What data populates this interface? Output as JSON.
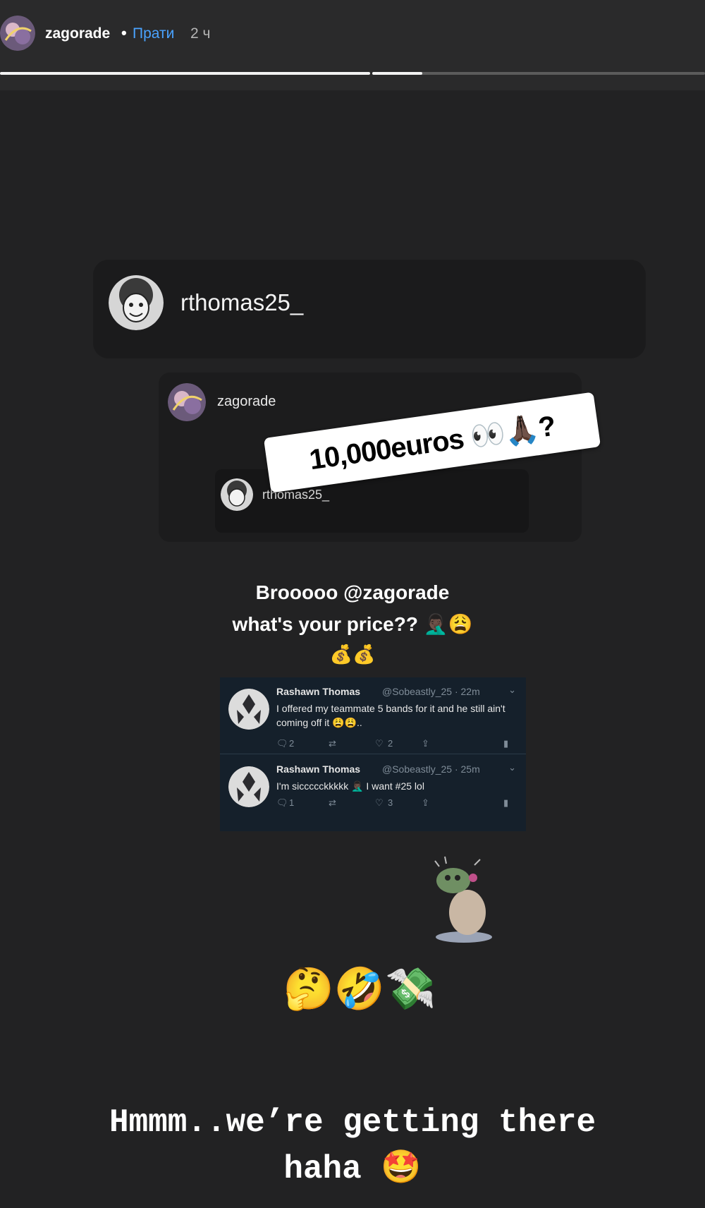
{
  "header": {
    "username": "zagorade",
    "separator": "•",
    "follow_label": "Прати",
    "time": "2 ч",
    "progress": [
      1.0,
      0.15
    ]
  },
  "repost": {
    "username": "rthomas25_",
    "inner": {
      "username": "zagorade",
      "nested_username": "rthomas25_"
    }
  },
  "sticker": {
    "text": "10,000euros 👀🙏🏿?"
  },
  "caption": {
    "line1": "Brooooo @zagorade",
    "line2": "what's your price?? 🤦🏿‍♂️😩",
    "line3": "💰💰"
  },
  "tweets": [
    {
      "name": "Rashawn Thomas",
      "handle": "@Sobeastly_25 · 22m",
      "text": "I offered my teammate 5 bands for it and he still ain't coming off it 😩😩..",
      "replies": "2",
      "likes": "2"
    },
    {
      "name": "Rashawn Thomas",
      "handle": "@Sobeastly_25 · 25m",
      "text": "I'm siccccckkkkk 🤦🏿‍♂️ I want #25 lol",
      "replies": "1",
      "likes": "3"
    }
  ],
  "emojis": "🤔🤣💸",
  "bottom": {
    "line1": "Hmmm..we’re getting there",
    "line2": "haha 🤩"
  },
  "icons": {
    "reply": "reply-icon",
    "retweet": "retweet-icon",
    "like": "heart-icon",
    "share": "share-icon",
    "analytics": "analytics-icon"
  }
}
